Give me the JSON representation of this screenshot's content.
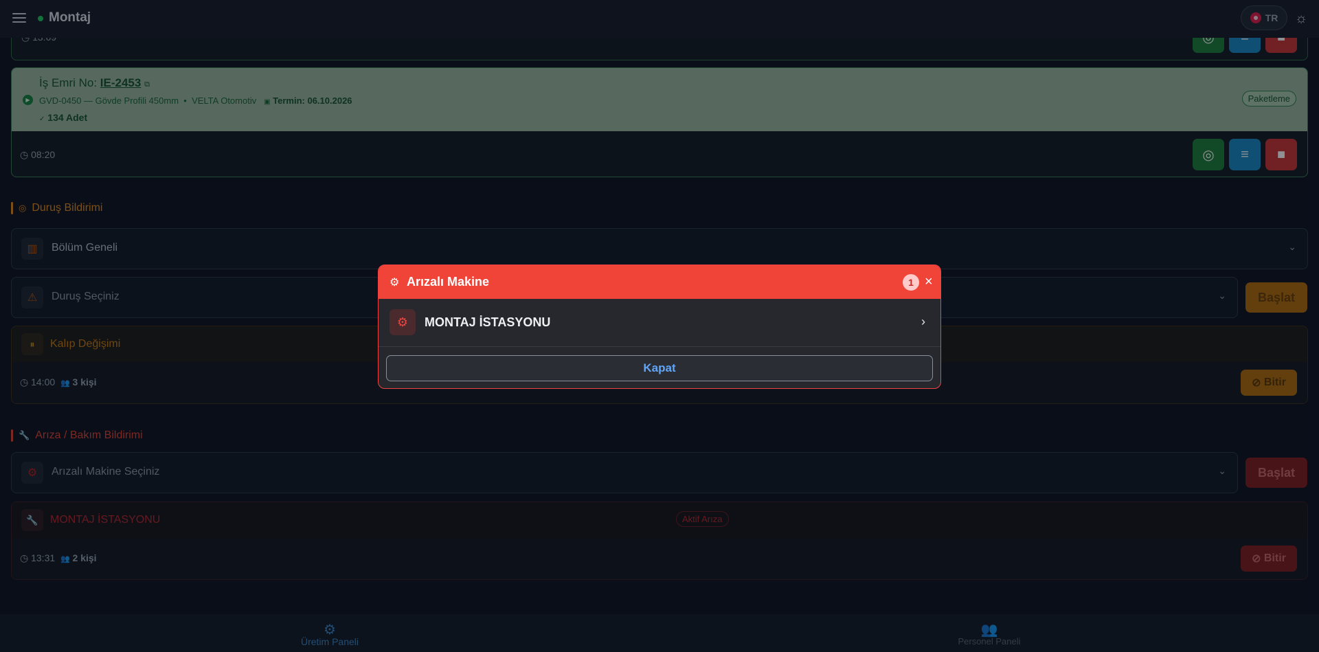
{
  "app": {
    "title": "Montaj",
    "lang": "TR"
  },
  "previous_card": {
    "time": "13:09"
  },
  "work_order": {
    "label": "İş Emri No:",
    "number": "IE-2453",
    "product": "GVD-0450 — Gövde Profili 450mm",
    "separator": "•",
    "customer": "VELTA Otomotiv",
    "deadline": "Termin: 06.10.2026",
    "quantity": "134 Adet",
    "badge": "Paketleme",
    "time": "08:20"
  },
  "downtime": {
    "section_title": "Duruş Bildirimi",
    "department_select": "Bölüm Geneli",
    "downtime_select": "Duruş Seçiniz",
    "start_label": "Başlat",
    "active": {
      "title": "Kalıp Değişimi",
      "time": "14:00",
      "people": "3 kişi",
      "finish_label": "Bitir"
    }
  },
  "fault": {
    "section_title": "Arıza / Bakım Bildirimi",
    "machine_select": "Arızalı Makine Seçiniz",
    "start_label": "Başlat",
    "active": {
      "title": "MONTAJ İSTASYONU",
      "status": "Aktif Arıza",
      "time": "13:31",
      "people": "2 kişi",
      "finish_label": "Bitir"
    }
  },
  "bottom_nav": [
    {
      "label": "Üretim Paneli",
      "icon": "robot-arm-icon",
      "active": true
    },
    {
      "label": "Personel Paneli",
      "icon": "users-icon",
      "active": false
    }
  ],
  "modal": {
    "title": "Arızalı Makine",
    "count": "1",
    "items": [
      {
        "label": "MONTAJ İSTASYONU"
      }
    ],
    "close_label": "Kapat"
  },
  "colors": {
    "accent_green": "#22c55e",
    "danger": "#ef4444",
    "warning": "#d97706",
    "info": "#1687c4"
  }
}
